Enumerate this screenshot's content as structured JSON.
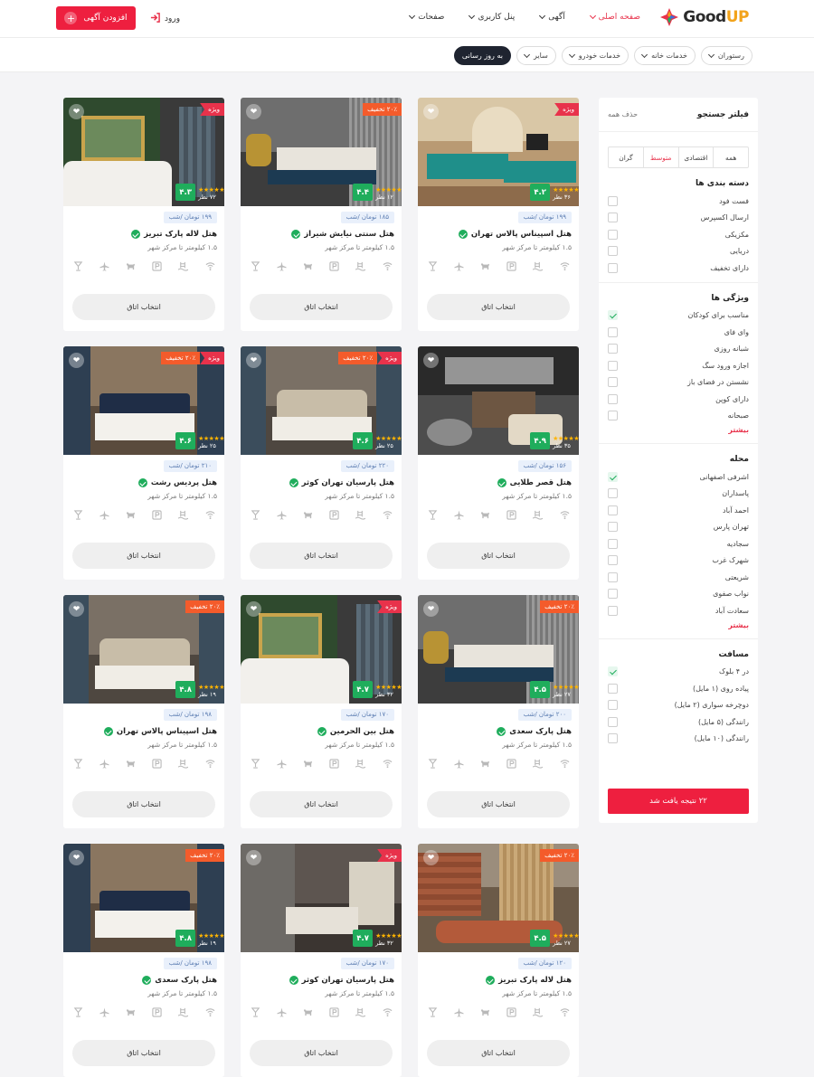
{
  "header": {
    "logo_good": "Good",
    "logo_up": "UP",
    "nav": [
      {
        "label": "صفحه اصلی",
        "active": true
      },
      {
        "label": "آگهی",
        "active": false
      },
      {
        "label": "پنل کاربری",
        "active": false
      },
      {
        "label": "صفحات",
        "active": false
      }
    ],
    "login_label": "ورود",
    "add_label": "افزودن آگهی"
  },
  "chips": [
    "رستوران",
    "خدمات خانه",
    "خدمات خودرو",
    "سایر",
    "به روز رسانی"
  ],
  "sidebar": {
    "title": "فیلتر جستجو",
    "clear": "حذف همه",
    "price_tabs": [
      "همه",
      "اقتصادی",
      "متوسط",
      "گران"
    ],
    "sections": [
      {
        "title": "دسته بندی ها",
        "items": [
          {
            "label": "فست فود",
            "checked": false
          },
          {
            "label": "ارسال اکسپرس",
            "checked": false
          },
          {
            "label": "مکزیکی",
            "checked": false
          },
          {
            "label": "دریایی",
            "checked": false
          },
          {
            "label": "دارای تخفیف",
            "checked": false
          }
        ],
        "more": ""
      },
      {
        "title": "ویژگی ها",
        "items": [
          {
            "label": "مناسب برای کودکان",
            "checked": true
          },
          {
            "label": "وای فای",
            "checked": false
          },
          {
            "label": "شبانه روزی",
            "checked": false
          },
          {
            "label": "اجازه ورود سگ",
            "checked": false
          },
          {
            "label": "نشستن در فضای باز",
            "checked": false
          },
          {
            "label": "دارای کوپن",
            "checked": false
          },
          {
            "label": "صبحانه",
            "checked": false
          }
        ],
        "more": "بیشتر"
      },
      {
        "title": "محله",
        "items": [
          {
            "label": "اشرفی اصفهانی",
            "checked": true
          },
          {
            "label": "پاسداران",
            "checked": false
          },
          {
            "label": "احمد آباد",
            "checked": false
          },
          {
            "label": "تهران پارس",
            "checked": false
          },
          {
            "label": "سجادیه",
            "checked": false
          },
          {
            "label": "شهرک غرب",
            "checked": false
          },
          {
            "label": "شریعتی",
            "checked": false
          },
          {
            "label": "نواب صفوی",
            "checked": false
          },
          {
            "label": "سعادت آباد",
            "checked": false
          }
        ],
        "more": "بیشتر"
      },
      {
        "title": "مسافت",
        "items": [
          {
            "label": "در ۴ بلوک",
            "checked": true
          },
          {
            "label": "پیاده روی (۱ مایل)",
            "checked": false
          },
          {
            "label": "دوچرخه سواری (۲ مایل)",
            "checked": false
          },
          {
            "label": "رانندگی (۵ مایل)",
            "checked": false
          },
          {
            "label": "رانندگی (۱۰ مایل)",
            "checked": false
          }
        ],
        "more": ""
      }
    ],
    "result_btn": "۲۲ نتیجه یافت شد"
  },
  "common": {
    "distance": "۱.۵ کیلومتر تا مرکز شهر",
    "select_btn": "انتخاب اتاق",
    "votes_suffix": "نظر"
  },
  "cards": [
    {
      "name": "هتل اسپیناس پالاس تهران",
      "price": "۱۹۹ تومان /شب",
      "rating": "۴.۲",
      "votes": "۳۶ نظر",
      "off": "",
      "vip": "ویژه",
      "theme": "a"
    },
    {
      "name": "هتل سنتی نیایش شیراز",
      "price": "۱۸۵ تومان /شب",
      "rating": "۴.۴",
      "votes": "۱۲ نظر",
      "off": "۲۰٪ تخفیف",
      "vip": "",
      "theme": "b"
    },
    {
      "name": "هتل لاله پارک تبریز",
      "price": "۱۹۹ تومان /شب",
      "rating": "۴.۳",
      "votes": "۷۲ نظر",
      "off": "",
      "vip": "ویژه",
      "theme": "c"
    },
    {
      "name": "هتل قصر طلایی",
      "price": "۱۵۶ تومان /شب",
      "rating": "۴.۹",
      "votes": "۳۵ نظر",
      "off": "",
      "vip": "",
      "theme": "d"
    },
    {
      "name": "هتل پارسیان تهران کوثر",
      "price": "۲۲۰ تومان /شب",
      "rating": "۴.۶",
      "votes": "۲۵ نظر",
      "off": "۲۰٪ تخفیف",
      "vip": "ویژه",
      "theme": "e"
    },
    {
      "name": "هتل پردیس رشت",
      "price": "۲۱۰ تومان /شب",
      "rating": "۴.۶",
      "votes": "۲۵ نظر",
      "off": "۲۰٪ تخفیف",
      "vip": "ویژه",
      "theme": "f"
    },
    {
      "name": "هتل پارک سعدی",
      "price": "۲۰۰ تومان /شب",
      "rating": "۴.۵",
      "votes": "۲۷ نظر",
      "off": "۲۰٪ تخفیف",
      "vip": "",
      "theme": "b"
    },
    {
      "name": "هتل بین الحرمین",
      "price": "۱۷۰ تومان /شب",
      "rating": "۴.۷",
      "votes": "۳۲ نظر",
      "off": "",
      "vip": "ویژه",
      "theme": "c"
    },
    {
      "name": "هتل اسپیناس پالاس تهران",
      "price": "۱۹۸ تومان /شب",
      "rating": "۴.۸",
      "votes": "۱۹ نظر",
      "off": "۲۰٪ تخفیف",
      "vip": "",
      "theme": "e"
    },
    {
      "name": "هتل لاله پارک تبریز",
      "price": "۱۲۰ تومان /شب",
      "rating": "۴.۵",
      "votes": "۲۷ نظر",
      "off": "۲۰٪ تخفیف",
      "vip": "",
      "theme": "g"
    },
    {
      "name": "هتل پارسیان تهران کوثر",
      "price": "۱۷۰ تومان /شب",
      "rating": "۴.۷",
      "votes": "۳۲ نظر",
      "off": "",
      "vip": "ویژه",
      "theme": "h"
    },
    {
      "name": "هتل پارک سعدی",
      "price": "۱۹۸ تومان /شب",
      "rating": "۴.۸",
      "votes": "۱۹ نظر",
      "off": "۲۰٪ تخفیف",
      "vip": "",
      "theme": "f"
    }
  ]
}
